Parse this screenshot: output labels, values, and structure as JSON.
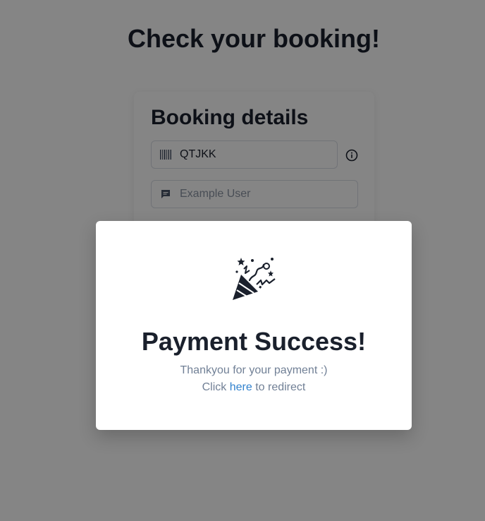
{
  "page": {
    "title": "Check your booking!"
  },
  "booking_card": {
    "title": "Booking details",
    "booking_code": {
      "value": "QTJKK",
      "icon": "barcode-icon"
    },
    "name_field": {
      "placeholder": "Example User",
      "icon": "message-icon"
    },
    "info_icon": "info-icon"
  },
  "modal": {
    "icon": "party-popper-icon",
    "title": "Payment Success!",
    "message": "Thankyou for your payment :)",
    "redirect_prefix": "Click ",
    "redirect_link": "here",
    "redirect_suffix": " to redirect"
  },
  "colors": {
    "heading": "#1a202c",
    "muted_text": "#718096",
    "link": "#3182ce",
    "overlay": "rgba(0,0,0,0.48)"
  }
}
